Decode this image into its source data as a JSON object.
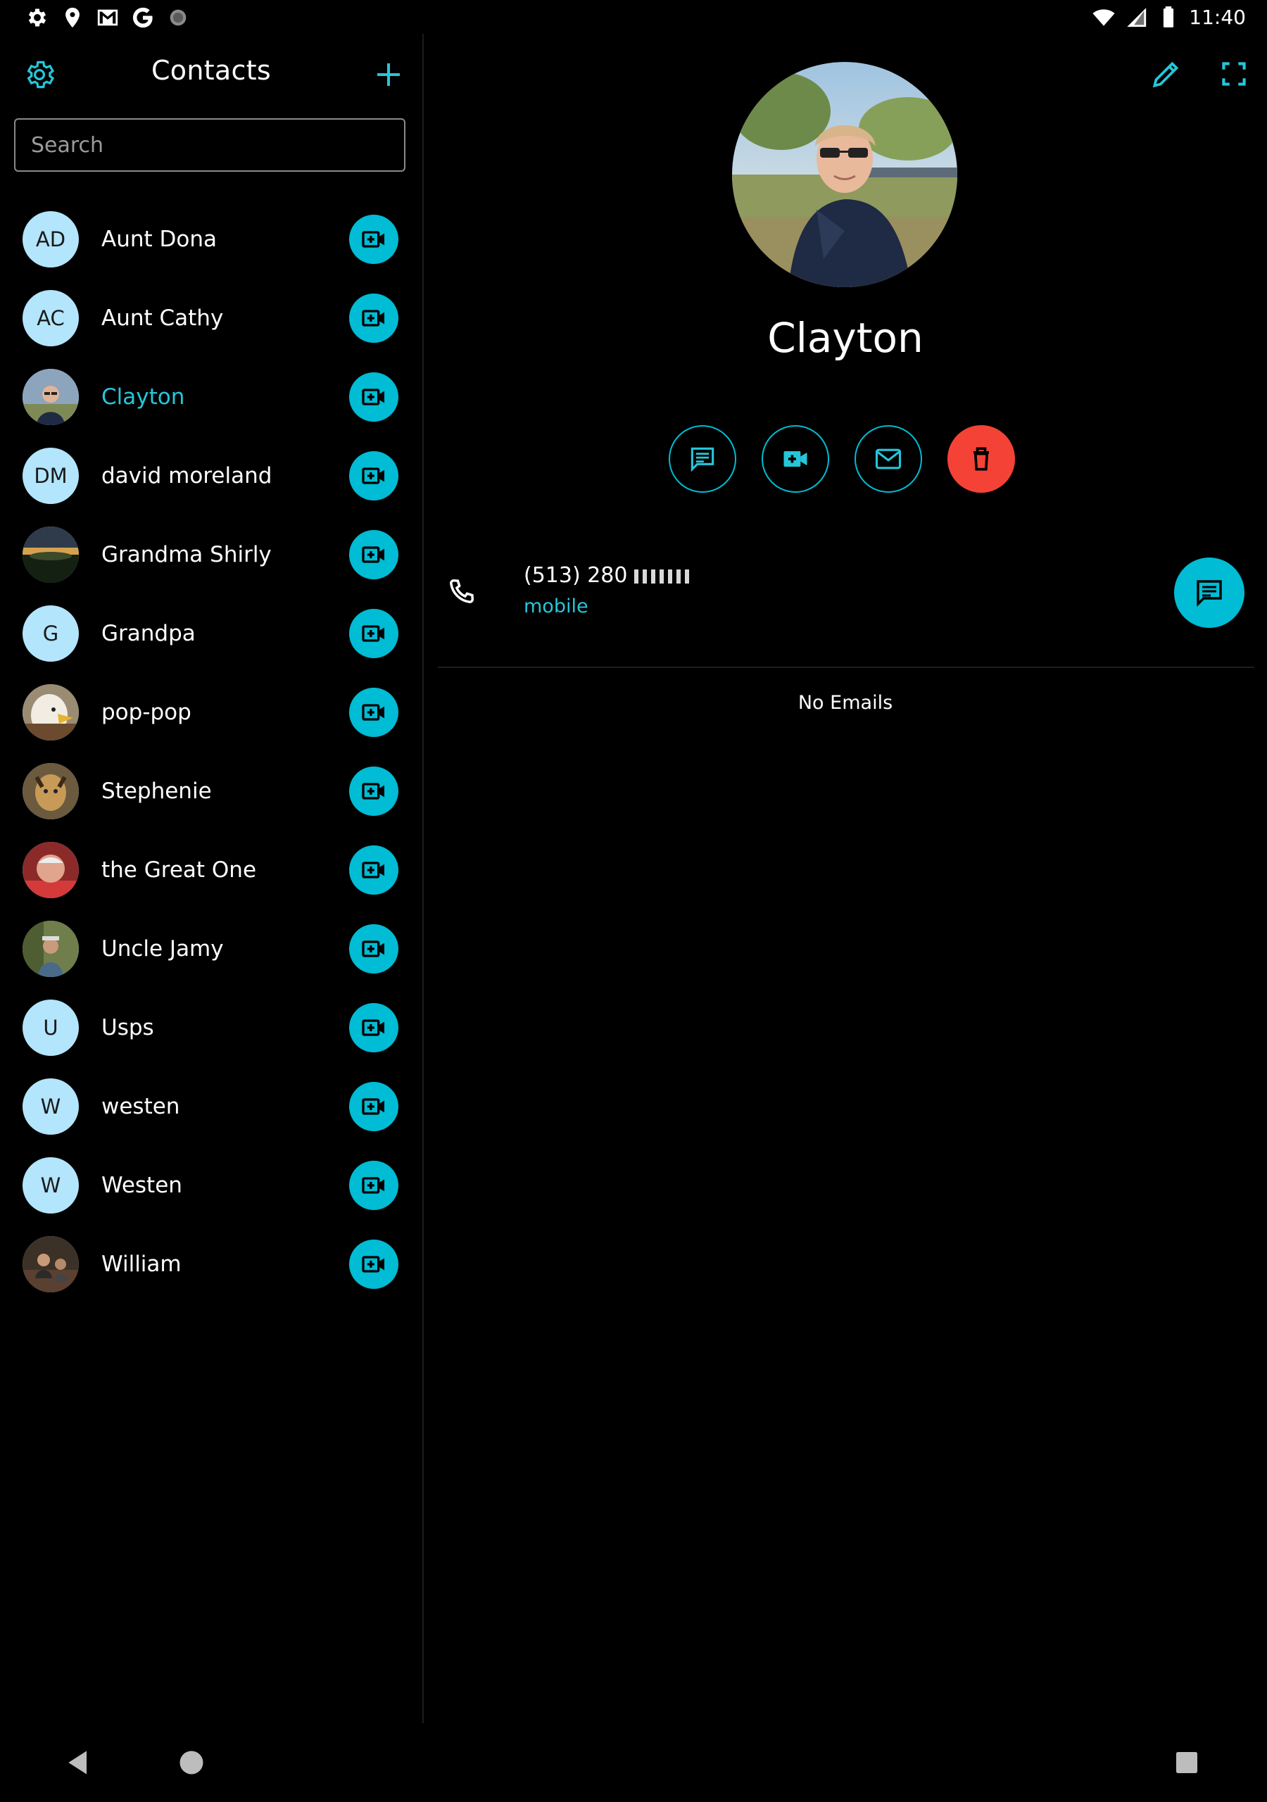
{
  "colors": {
    "accent": "#00bcd4",
    "accent_text": "#26c6da",
    "delete": "#f44336",
    "avatar_bg": "#b3e5fc",
    "background": "#000000"
  },
  "status_bar": {
    "time": "11:40",
    "left_icons": [
      "settings-icon",
      "location-icon",
      "gmail-icon",
      "google-icon",
      "circle-icon"
    ],
    "right_icons": [
      "wifi-icon",
      "signal-icon",
      "battery-icon"
    ]
  },
  "contacts_panel": {
    "title": "Contacts",
    "search_placeholder": "Search",
    "contacts": [
      {
        "name": "Aunt Dona",
        "initials": "AD",
        "has_photo": false,
        "selected": false
      },
      {
        "name": "Aunt Cathy",
        "initials": "AC",
        "has_photo": false,
        "selected": false
      },
      {
        "name": "Clayton",
        "initials": "",
        "has_photo": true,
        "selected": true
      },
      {
        "name": "david moreland",
        "initials": "DM",
        "has_photo": false,
        "selected": false
      },
      {
        "name": "Grandma Shirly",
        "initials": "",
        "has_photo": true,
        "selected": false
      },
      {
        "name": "Grandpa",
        "initials": "G",
        "has_photo": false,
        "selected": false
      },
      {
        "name": "pop-pop",
        "initials": "",
        "has_photo": true,
        "selected": false
      },
      {
        "name": "Stephenie",
        "initials": "",
        "has_photo": true,
        "selected": false
      },
      {
        "name": "the Great One",
        "initials": "",
        "has_photo": true,
        "selected": false
      },
      {
        "name": "Uncle Jamy",
        "initials": "",
        "has_photo": true,
        "selected": false
      },
      {
        "name": "Usps",
        "initials": "U",
        "has_photo": false,
        "selected": false
      },
      {
        "name": "westen",
        "initials": "W",
        "has_photo": false,
        "selected": false
      },
      {
        "name": "Westen",
        "initials": "W",
        "has_photo": false,
        "selected": false
      },
      {
        "name": "William",
        "initials": "",
        "has_photo": true,
        "selected": false
      }
    ]
  },
  "detail": {
    "name": "Clayton",
    "phone": {
      "number_visible": "(513) 280",
      "type": "mobile"
    },
    "no_emails_text": "No Emails"
  }
}
